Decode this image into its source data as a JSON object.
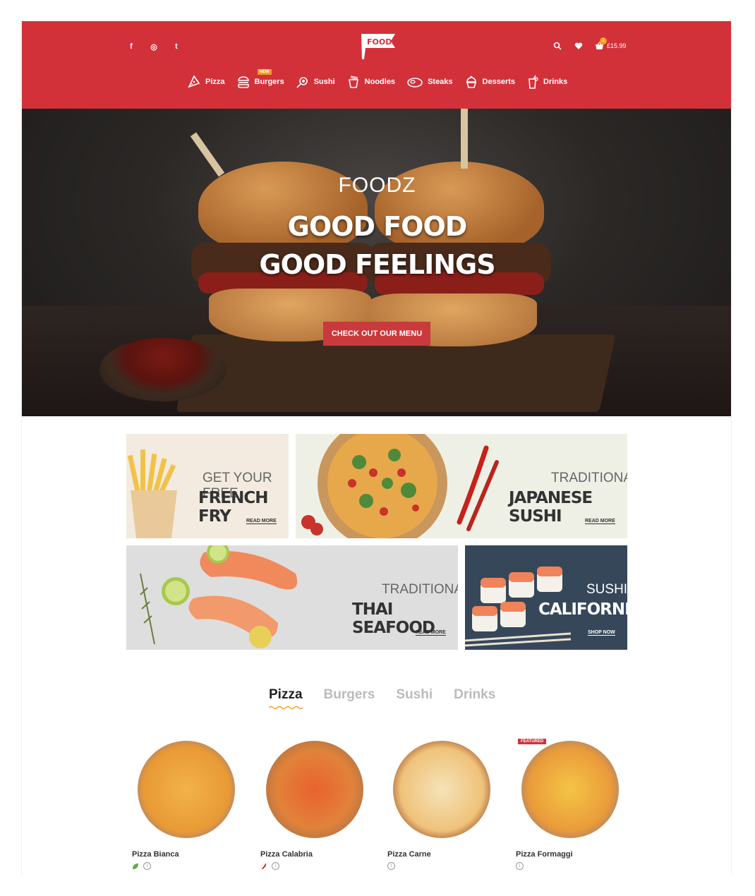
{
  "header": {
    "social": [
      "f",
      "◎",
      "t"
    ],
    "logo_text": "FOODZ",
    "cart_count": "1",
    "cart_total": "£15.99",
    "categories": [
      {
        "label": "Pizza",
        "icon": "pizza-slice-icon"
      },
      {
        "label": "Burgers",
        "icon": "burger-icon",
        "tag": "NEW"
      },
      {
        "label": "Sushi",
        "icon": "sushi-icon"
      },
      {
        "label": "Noodles",
        "icon": "noodles-icon"
      },
      {
        "label": "Steaks",
        "icon": "steak-icon"
      },
      {
        "label": "Desserts",
        "icon": "cupcake-icon"
      },
      {
        "label": "Drinks",
        "icon": "drink-icon"
      }
    ]
  },
  "hero": {
    "subtitle": "FOODZ",
    "title_line1": "GOOD FOOD",
    "title_line2": "GOOD FEELINGS",
    "button": "CHECK OUT OUR MENU"
  },
  "banners": [
    {
      "line1": "GET YOUR FREE",
      "line2": "FRENCH FRY",
      "link": "READ MORE"
    },
    {
      "line1": "TRADITIONAL",
      "line2": "JAPANESE SUSHI",
      "link": "READ MORE"
    },
    {
      "line1": "TRADITIONAL",
      "line2": "THAI SEAFOOD",
      "link": "READ MORE"
    },
    {
      "line1": "SUSHI",
      "line2": "CALIFORNIA",
      "link": "SHOP NOW"
    }
  ],
  "tabs": [
    "Pizza",
    "Burgers",
    "Sushi",
    "Drinks"
  ],
  "products": [
    {
      "name": "Pizza Bianca"
    },
    {
      "name": "Pizza Calabria"
    },
    {
      "name": "Pizza Carne"
    },
    {
      "name": "Pizza Formaggi",
      "badge": "FEATURED"
    }
  ],
  "colors": {
    "brand": "#d3313a",
    "accent": "#f3a11c"
  }
}
